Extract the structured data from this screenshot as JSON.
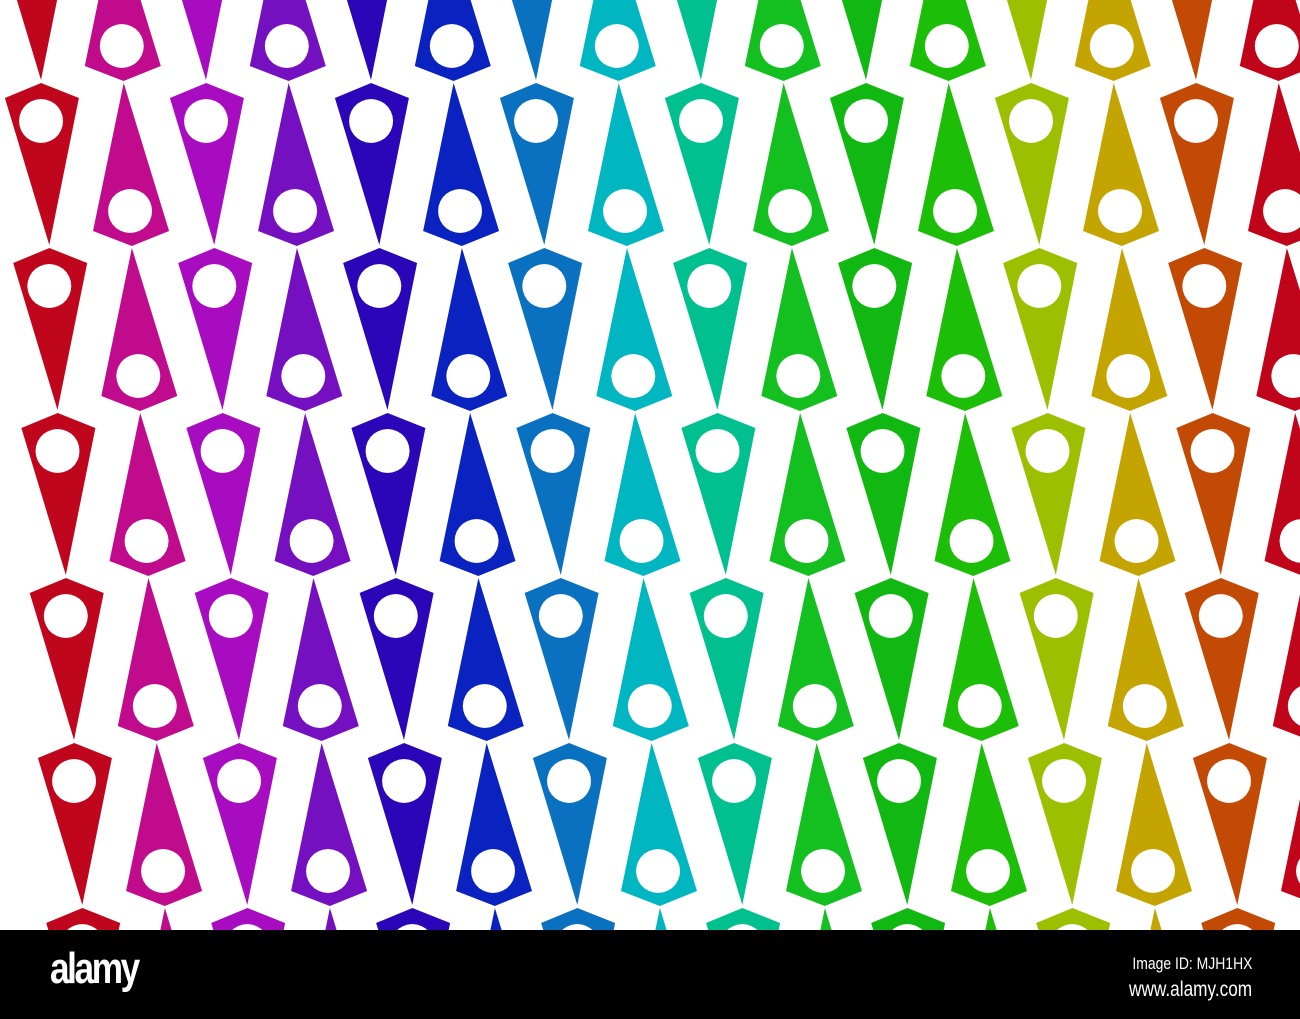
{
  "pattern": {
    "palette": [
      "#c0061c",
      "#c00c8c",
      "#a80cc0",
      "#7410c0",
      "#2a06b8",
      "#0a22c0",
      "#0a70c0",
      "#00b6c0",
      "#00c090",
      "#14bf20",
      "#12b812",
      "#1cbe08",
      "#9cc000",
      "#c4a400",
      "#c24a04",
      "#c0041a"
    ]
  },
  "footer": {
    "logo": "alamy",
    "image_id": "Image ID: MJH1HX",
    "website": "www.alamy.com"
  }
}
